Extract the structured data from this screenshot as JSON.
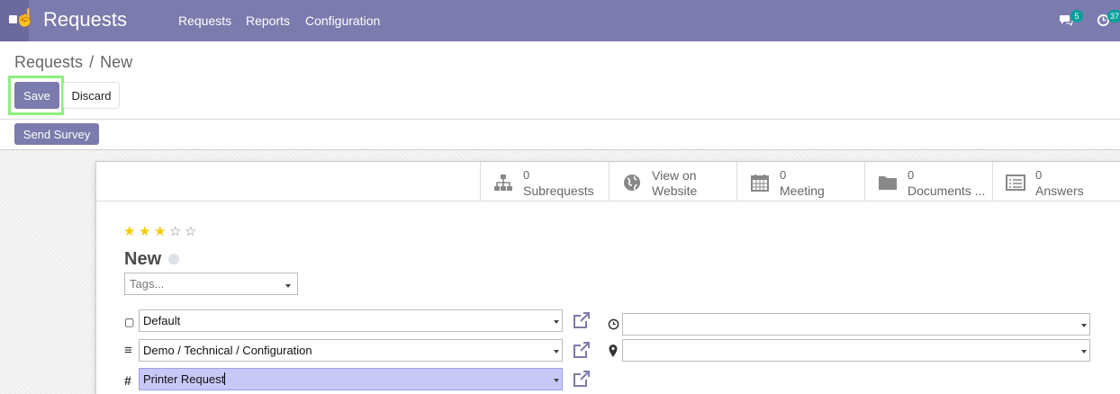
{
  "navbar": {
    "brand": "Requests",
    "menu": [
      "Requests",
      "Reports",
      "Configuration"
    ],
    "messages_count": "5",
    "activities_count": "37"
  },
  "breadcrumb": {
    "parent": "Requests",
    "separator": "/",
    "current": "New"
  },
  "buttons": {
    "save": "Save",
    "discard": "Discard",
    "send_survey": "Send Survey"
  },
  "stat_buttons": [
    {
      "icon": "sitemap-icon",
      "value": "0",
      "label": "Subrequests"
    },
    {
      "icon": "globe-icon",
      "line1": "View on",
      "label": "Website"
    },
    {
      "icon": "calendar-icon",
      "value": "0",
      "label": "Meeting"
    },
    {
      "icon": "folder-icon",
      "value": "0",
      "label": "Documents ..."
    },
    {
      "icon": "list-icon",
      "value": "0",
      "label": "Answers"
    }
  ],
  "form": {
    "priority": {
      "stars_filled": 3,
      "stars_total": 5
    },
    "title": "New",
    "tags_placeholder": "Tags...",
    "left_fields": [
      {
        "icon": "square-icon",
        "value": "Default"
      },
      {
        "icon": "bars-icon",
        "value": "Demo / Technical / Configuration"
      },
      {
        "icon": "hash-icon",
        "value": "Printer Request"
      }
    ],
    "right_fields": [
      {
        "icon": "clock-icon",
        "value": ""
      },
      {
        "icon": "map-marker-icon",
        "value": ""
      }
    ]
  },
  "colors": {
    "brand": "#7c7bad",
    "highlight": "#90ee7e",
    "star": "#f3cc00",
    "active_field": "#c8c8f8"
  }
}
